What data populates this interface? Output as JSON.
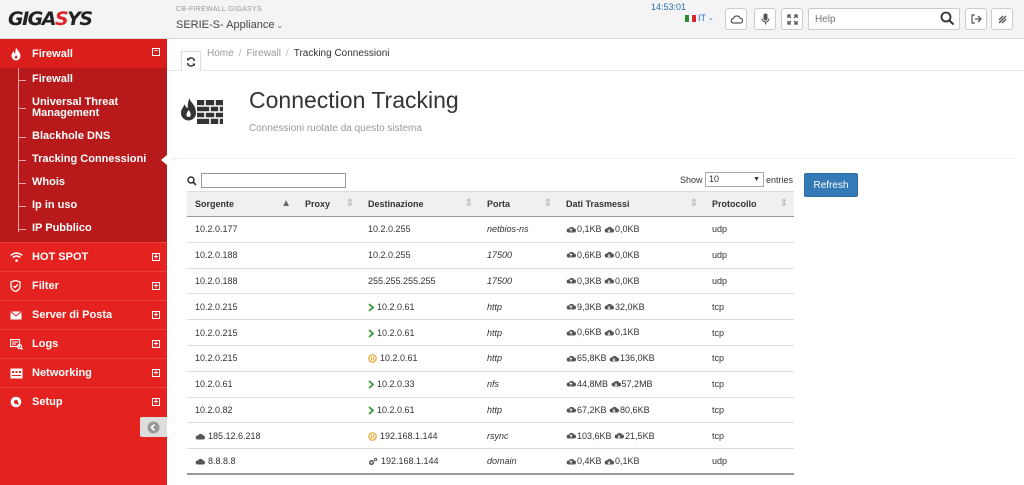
{
  "header": {
    "logo": {
      "part1": "GIGA",
      "part2": "S",
      "part3": "YS"
    },
    "device_host": "CB-FIREWALL.GIGASYS",
    "device_series": "SERIE-S- Appliance",
    "clock": "14:53:01",
    "language": "IT",
    "search_placeholder": "Help"
  },
  "sidebar": {
    "section_title": "Firewall",
    "section_toggle": "⊟",
    "sub_items": [
      {
        "label": "Firewall",
        "active": false
      },
      {
        "label": "Universal Threat Management",
        "active": false
      },
      {
        "label": "Blackhole DNS",
        "active": false
      },
      {
        "label": "Tracking Connessioni",
        "active": true
      },
      {
        "label": "Whois",
        "active": false
      },
      {
        "label": "Ip in uso",
        "active": false
      },
      {
        "label": "IP Pubblico",
        "active": false
      }
    ],
    "items": [
      {
        "label": "HOT SPOT",
        "icon": "wifi-icon"
      },
      {
        "label": "Filter",
        "icon": "shield-icon"
      },
      {
        "label": "Server di Posta",
        "icon": "envelope-icon"
      },
      {
        "label": "Logs",
        "icon": "logs-icon"
      },
      {
        "label": "Networking",
        "icon": "network-icon"
      },
      {
        "label": "Setup",
        "icon": "gear-icon"
      }
    ],
    "item_toggle": "⊞"
  },
  "breadcrumb": {
    "home": "Home",
    "section": "Firewall",
    "current": "Tracking Connessioni",
    "sep": "/"
  },
  "page": {
    "title": "Connection Tracking",
    "subtitle": "Connessioni ruotate da questo sistema"
  },
  "table_controls": {
    "show_label": "Show",
    "show_value": "10",
    "entries_label": "entries",
    "refresh_label": "Refresh",
    "filter_value": ""
  },
  "table": {
    "columns": [
      "Sorgente",
      "Proxy",
      "Destinazione",
      "Porta",
      "Dati Trasmessi",
      "Protocollo"
    ],
    "rows": [
      {
        "src": "10.2.0.177",
        "src_icon": "",
        "proxy": "",
        "dest": "10.2.0.255",
        "dest_icon": "",
        "port": "netbios-ns",
        "sent": "0,1KB",
        "recv": "0,0KB",
        "proto": "udp"
      },
      {
        "src": "10.2.0.188",
        "src_icon": "",
        "proxy": "",
        "dest": "10.2.0.255",
        "dest_icon": "",
        "port": "17500",
        "sent": "0,6KB",
        "recv": "0,0KB",
        "proto": "udp"
      },
      {
        "src": "10.2.0.188",
        "src_icon": "",
        "proxy": "",
        "dest": "255.255.255.255",
        "dest_icon": "",
        "port": "17500",
        "sent": "0,3KB",
        "recv": "0,0KB",
        "proto": "udp"
      },
      {
        "src": "10.2.0.215",
        "src_icon": "",
        "proxy": "",
        "dest": "10.2.0.61",
        "dest_icon": "chevron",
        "port": "http",
        "sent": "9,3KB",
        "recv": "32,0KB",
        "proto": "tcp"
      },
      {
        "src": "10.2.0.215",
        "src_icon": "",
        "proxy": "",
        "dest": "10.2.0.61",
        "dest_icon": "chevron",
        "port": "http",
        "sent": "0,6KB",
        "recv": "0,1KB",
        "proto": "tcp"
      },
      {
        "src": "10.2.0.215",
        "src_icon": "",
        "proxy": "",
        "dest": "10.2.0.61",
        "dest_icon": "warning",
        "port": "http",
        "sent": "65,8KB",
        "recv": "136,0KB",
        "proto": "tcp"
      },
      {
        "src": "10.2.0.61",
        "src_icon": "",
        "proxy": "",
        "dest": "10.2.0.33",
        "dest_icon": "chevron",
        "port": "nfs",
        "sent": "44,8MB",
        "recv": "57,2MB",
        "proto": "tcp"
      },
      {
        "src": "10.2.0.82",
        "src_icon": "",
        "proxy": "",
        "dest": "10.2.0.61",
        "dest_icon": "chevron",
        "port": "http",
        "sent": "67,2KB",
        "recv": "80,6KB",
        "proto": "tcp"
      },
      {
        "src": "185.12.6.218",
        "src_icon": "cloud",
        "proxy": "",
        "dest": "192.168.1.144",
        "dest_icon": "warning",
        "port": "rsync",
        "sent": "103,6KB",
        "recv": "21,5KB",
        "proto": "tcp"
      },
      {
        "src": "8.8.8.8",
        "src_icon": "cloud",
        "proxy": "",
        "dest": "192.168.1.144",
        "dest_icon": "gears",
        "port": "domain",
        "sent": "0,4KB",
        "recv": "0,1KB",
        "proto": "udp"
      }
    ]
  },
  "colors": {
    "brand_red": "#e42320",
    "submenu_red": "#b8191a",
    "link_blue": "#2a6db1",
    "button_blue": "#337ab7",
    "chevron_green": "#3a9a3a",
    "warning_orange": "#f0a020"
  }
}
